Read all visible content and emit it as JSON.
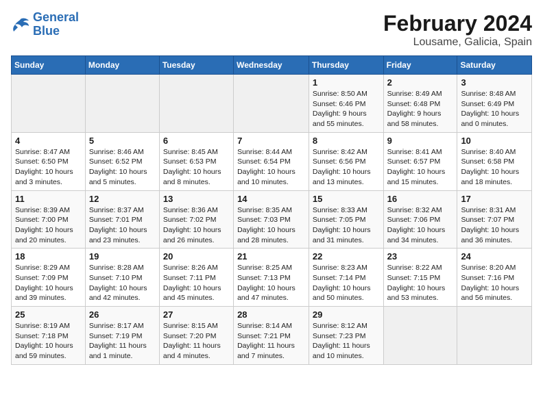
{
  "logo": {
    "text_general": "General",
    "text_blue": "Blue"
  },
  "header": {
    "month": "February 2024",
    "location": "Lousame, Galicia, Spain"
  },
  "weekdays": [
    "Sunday",
    "Monday",
    "Tuesday",
    "Wednesday",
    "Thursday",
    "Friday",
    "Saturday"
  ],
  "weeks": [
    [
      {
        "day": "",
        "info": ""
      },
      {
        "day": "",
        "info": ""
      },
      {
        "day": "",
        "info": ""
      },
      {
        "day": "",
        "info": ""
      },
      {
        "day": "1",
        "info": "Sunrise: 8:50 AM\nSunset: 6:46 PM\nDaylight: 9 hours and 55 minutes."
      },
      {
        "day": "2",
        "info": "Sunrise: 8:49 AM\nSunset: 6:48 PM\nDaylight: 9 hours and 58 minutes."
      },
      {
        "day": "3",
        "info": "Sunrise: 8:48 AM\nSunset: 6:49 PM\nDaylight: 10 hours and 0 minutes."
      }
    ],
    [
      {
        "day": "4",
        "info": "Sunrise: 8:47 AM\nSunset: 6:50 PM\nDaylight: 10 hours and 3 minutes."
      },
      {
        "day": "5",
        "info": "Sunrise: 8:46 AM\nSunset: 6:52 PM\nDaylight: 10 hours and 5 minutes."
      },
      {
        "day": "6",
        "info": "Sunrise: 8:45 AM\nSunset: 6:53 PM\nDaylight: 10 hours and 8 minutes."
      },
      {
        "day": "7",
        "info": "Sunrise: 8:44 AM\nSunset: 6:54 PM\nDaylight: 10 hours and 10 minutes."
      },
      {
        "day": "8",
        "info": "Sunrise: 8:42 AM\nSunset: 6:56 PM\nDaylight: 10 hours and 13 minutes."
      },
      {
        "day": "9",
        "info": "Sunrise: 8:41 AM\nSunset: 6:57 PM\nDaylight: 10 hours and 15 minutes."
      },
      {
        "day": "10",
        "info": "Sunrise: 8:40 AM\nSunset: 6:58 PM\nDaylight: 10 hours and 18 minutes."
      }
    ],
    [
      {
        "day": "11",
        "info": "Sunrise: 8:39 AM\nSunset: 7:00 PM\nDaylight: 10 hours and 20 minutes."
      },
      {
        "day": "12",
        "info": "Sunrise: 8:37 AM\nSunset: 7:01 PM\nDaylight: 10 hours and 23 minutes."
      },
      {
        "day": "13",
        "info": "Sunrise: 8:36 AM\nSunset: 7:02 PM\nDaylight: 10 hours and 26 minutes."
      },
      {
        "day": "14",
        "info": "Sunrise: 8:35 AM\nSunset: 7:03 PM\nDaylight: 10 hours and 28 minutes."
      },
      {
        "day": "15",
        "info": "Sunrise: 8:33 AM\nSunset: 7:05 PM\nDaylight: 10 hours and 31 minutes."
      },
      {
        "day": "16",
        "info": "Sunrise: 8:32 AM\nSunset: 7:06 PM\nDaylight: 10 hours and 34 minutes."
      },
      {
        "day": "17",
        "info": "Sunrise: 8:31 AM\nSunset: 7:07 PM\nDaylight: 10 hours and 36 minutes."
      }
    ],
    [
      {
        "day": "18",
        "info": "Sunrise: 8:29 AM\nSunset: 7:09 PM\nDaylight: 10 hours and 39 minutes."
      },
      {
        "day": "19",
        "info": "Sunrise: 8:28 AM\nSunset: 7:10 PM\nDaylight: 10 hours and 42 minutes."
      },
      {
        "day": "20",
        "info": "Sunrise: 8:26 AM\nSunset: 7:11 PM\nDaylight: 10 hours and 45 minutes."
      },
      {
        "day": "21",
        "info": "Sunrise: 8:25 AM\nSunset: 7:13 PM\nDaylight: 10 hours and 47 minutes."
      },
      {
        "day": "22",
        "info": "Sunrise: 8:23 AM\nSunset: 7:14 PM\nDaylight: 10 hours and 50 minutes."
      },
      {
        "day": "23",
        "info": "Sunrise: 8:22 AM\nSunset: 7:15 PM\nDaylight: 10 hours and 53 minutes."
      },
      {
        "day": "24",
        "info": "Sunrise: 8:20 AM\nSunset: 7:16 PM\nDaylight: 10 hours and 56 minutes."
      }
    ],
    [
      {
        "day": "25",
        "info": "Sunrise: 8:19 AM\nSunset: 7:18 PM\nDaylight: 10 hours and 59 minutes."
      },
      {
        "day": "26",
        "info": "Sunrise: 8:17 AM\nSunset: 7:19 PM\nDaylight: 11 hours and 1 minute."
      },
      {
        "day": "27",
        "info": "Sunrise: 8:15 AM\nSunset: 7:20 PM\nDaylight: 11 hours and 4 minutes."
      },
      {
        "day": "28",
        "info": "Sunrise: 8:14 AM\nSunset: 7:21 PM\nDaylight: 11 hours and 7 minutes."
      },
      {
        "day": "29",
        "info": "Sunrise: 8:12 AM\nSunset: 7:23 PM\nDaylight: 11 hours and 10 minutes."
      },
      {
        "day": "",
        "info": ""
      },
      {
        "day": "",
        "info": ""
      }
    ]
  ]
}
